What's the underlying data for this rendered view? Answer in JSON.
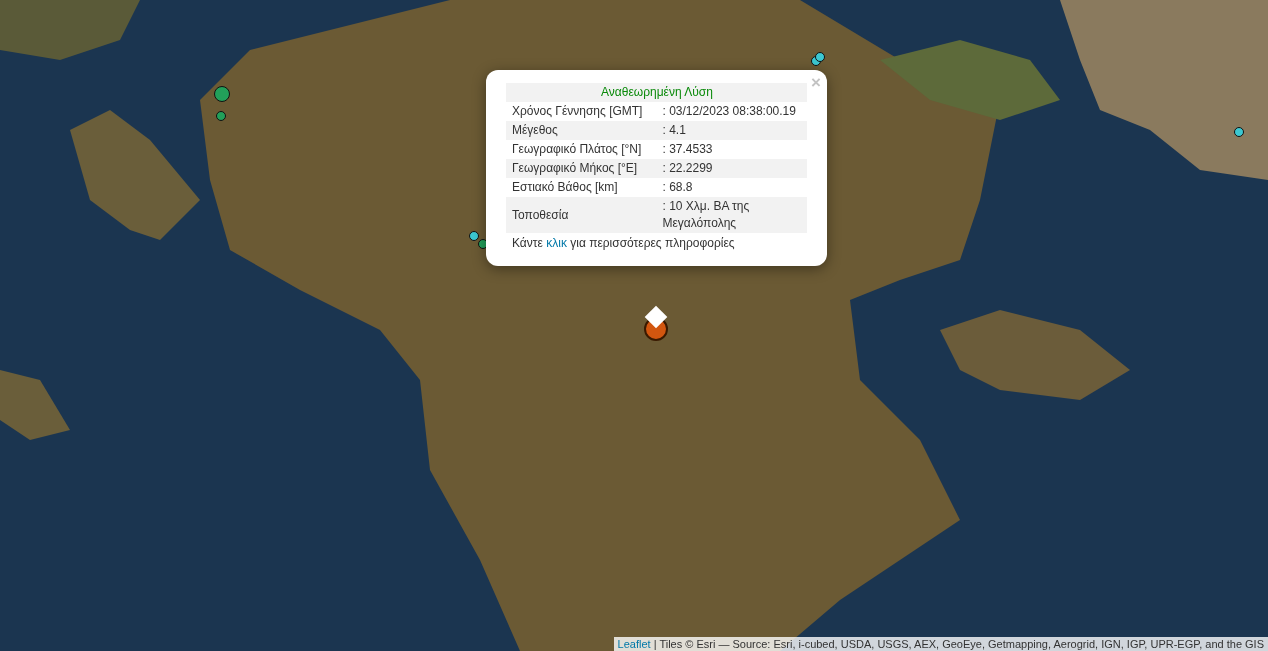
{
  "map": {
    "markers": [
      {
        "color": "#22a05a",
        "selected": false
      },
      {
        "color": "#22a05a",
        "selected": false
      },
      {
        "color": "#3cc8d2",
        "selected": false
      },
      {
        "color": "#22a05a",
        "selected": false
      },
      {
        "color": "#3cc8d2",
        "selected": false
      },
      {
        "color": "#3cc8d2",
        "selected": false
      },
      {
        "color": "#3cc8d2",
        "selected": false
      },
      {
        "color": "#d2560f",
        "selected": true
      }
    ]
  },
  "popup": {
    "close": "×",
    "title": "Αναθεωρημένη Λύση",
    "rows": [
      {
        "label": "Χρόνος Γέννησης [GMT]",
        "value": ": 03/12/2023 08:38:00.19"
      },
      {
        "label": "Μέγεθος",
        "value": ": 4.1"
      },
      {
        "label": "Γεωγραφικό Πλάτος [°N]",
        "value": ": 37.4533"
      },
      {
        "label": "Γεωγραφικό Μήκος [°E]",
        "value": ": 22.2299"
      },
      {
        "label": "Εστιακό Βάθος [km]",
        "value": ": 68.8"
      },
      {
        "label": "Τοποθεσία",
        "value": ": 10 Χλμ. ΒΑ της Μεγαλόπολης"
      }
    ],
    "footer": {
      "before": "Κάντε",
      "link": "κλικ",
      "after": "για περισσότερες πληροφορίες"
    }
  },
  "attribution": {
    "link": "Leaflet",
    "text": "| Tiles © Esri — Source: Esri, i-cubed, USDA, USGS, AEX, GeoEye, Getmapping, Aerogrid, IGN, IGP, UPR-EGP, and the GIS"
  }
}
